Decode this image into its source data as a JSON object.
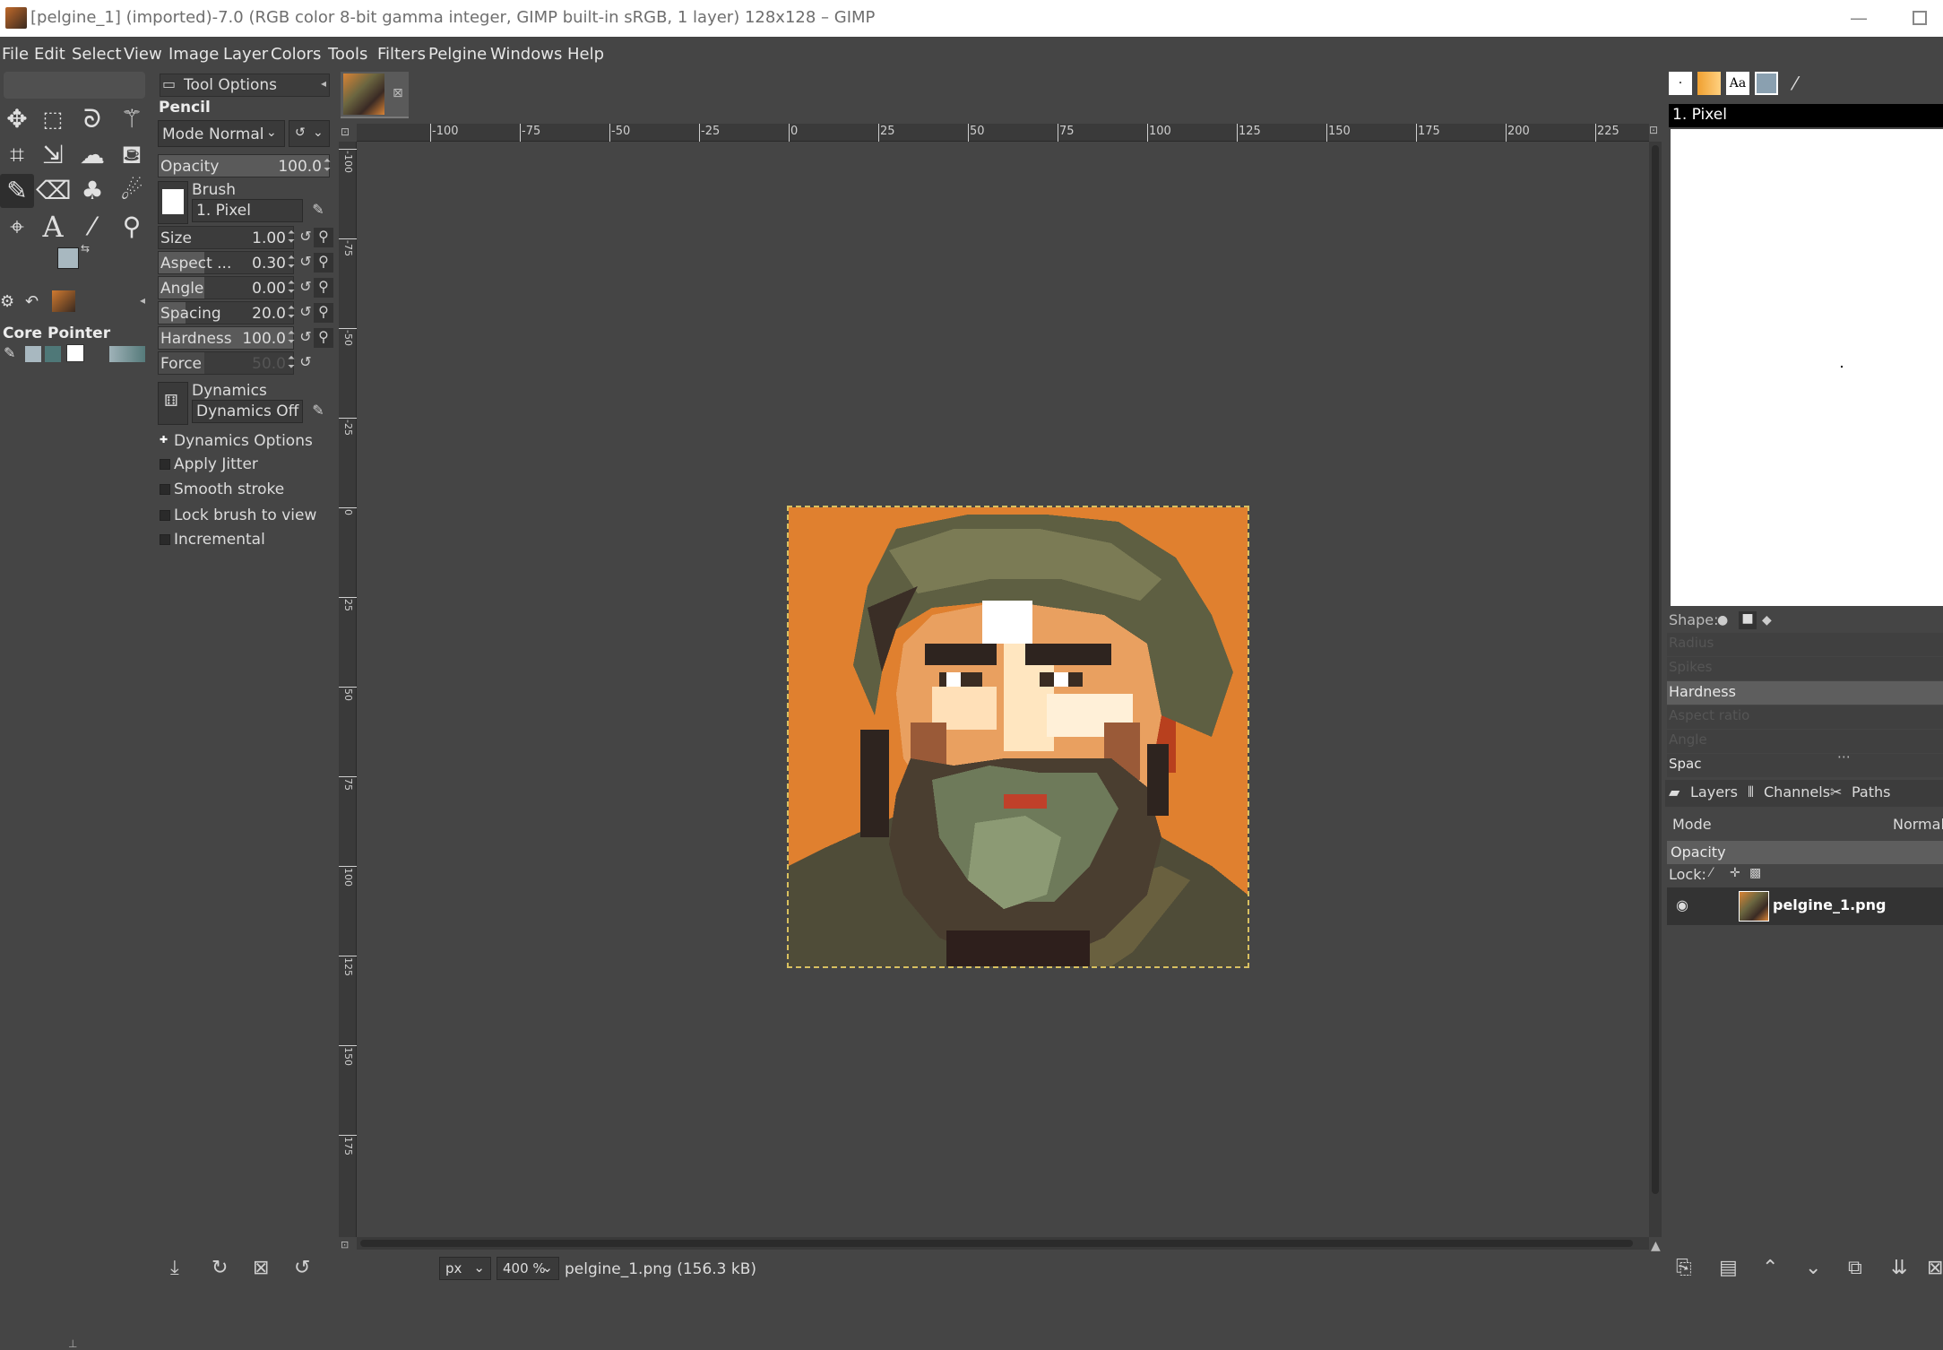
{
  "window": {
    "title": "[pelgine_1] (imported)-7.0 (RGB color 8-bit gamma integer, GIMP built-in sRGB, 1 layer) 128x128 – GIMP"
  },
  "menu": [
    "File",
    "Edit",
    "Select",
    "View",
    "Image",
    "Layer",
    "Colors",
    "Tools",
    "Filters",
    "Pelgine",
    "Windows",
    "Help"
  ],
  "toolbox": {
    "device_label": "Core Pointer"
  },
  "tool_options": {
    "tab_label": "Tool Options",
    "tool_name": "Pencil",
    "mode_label": "Mode",
    "mode_value": "Normal",
    "opacity": {
      "label": "Opacity",
      "value": "100.0"
    },
    "brush": {
      "label": "Brush",
      "value": "1. Pixel"
    },
    "size": {
      "label": "Size",
      "value": "1.00"
    },
    "aspect": {
      "label": "Aspect ...",
      "value": "0.30"
    },
    "angle": {
      "label": "Angle",
      "value": "0.00"
    },
    "spacing": {
      "label": "Spacing",
      "value": "20.0"
    },
    "hardness": {
      "label": "Hardness",
      "value": "100.0"
    },
    "force": {
      "label": "Force",
      "value": "50.0"
    },
    "dynamics": {
      "label": "Dynamics",
      "value": "Dynamics Off"
    },
    "options": [
      {
        "label": "Dynamics Options",
        "expander": true
      },
      {
        "label": "Apply Jitter",
        "checked": false
      },
      {
        "label": "Smooth stroke",
        "checked": false
      },
      {
        "label": "Lock brush to view",
        "checked": false
      },
      {
        "label": "Incremental",
        "checked": false
      }
    ]
  },
  "ruler": {
    "h_ticks": [
      "-100",
      "-75",
      "-50",
      "-25",
      "0",
      "25",
      "50",
      "75",
      "100",
      "125",
      "150",
      "175",
      "200",
      "225"
    ],
    "v_ticks": [
      "-100",
      "-75",
      "-50",
      "-25",
      "0",
      "25",
      "50",
      "75",
      "100",
      "125",
      "150",
      "175"
    ]
  },
  "status": {
    "unit": "px",
    "zoom": "400 %",
    "file_info": "pelgine_1.png (156.3 kB)"
  },
  "right_dock": {
    "brush_name": "1. Pixel",
    "shape_label": "Shape:",
    "params": [
      "Radius",
      "Spikes",
      "Hardness",
      "Aspect ratio",
      "Angle",
      "Spacing"
    ],
    "active_param": "Hardness",
    "spacing_partial": "Spac",
    "tabs": [
      "Layers",
      "Channels",
      "Paths"
    ],
    "mode_label": "Mode",
    "mode_value": "Normal",
    "opacity_label": "Opacity",
    "lock_label": "Lock:",
    "layer_name": "pelgine_1.png"
  },
  "colors": {
    "accent_bg": "#454545",
    "image_orange": "#e08030"
  }
}
